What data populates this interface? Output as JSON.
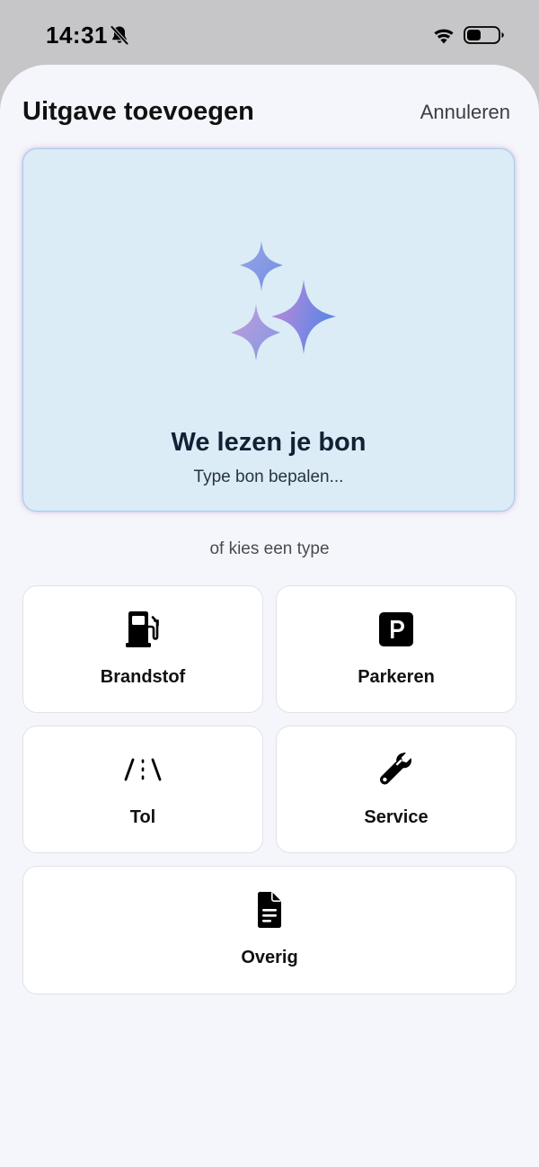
{
  "status_bar": {
    "time": "14:31",
    "icons": [
      "bell-slash-icon",
      "wifi-icon",
      "battery-icon"
    ]
  },
  "sheet": {
    "title": "Uitgave toevoegen",
    "cancel_label": "Annuleren"
  },
  "scan_card": {
    "icon": "sparkles-icon",
    "title": "We lezen je bon",
    "subtitle": "Type bon bepalen..."
  },
  "divider_text": "of kies een type",
  "types": [
    {
      "label": "Brandstof",
      "icon": "fuel-pump-icon"
    },
    {
      "label": "Parkeren",
      "icon": "parking-icon"
    },
    {
      "label": "Tol",
      "icon": "road-icon"
    },
    {
      "label": "Service",
      "icon": "wrench-icon"
    },
    {
      "label": "Overig",
      "icon": "document-icon"
    }
  ],
  "colors": {
    "sheet_background": "#f5f6fb",
    "scan_card_background": "#dbecf7",
    "sparkle_gradient_start": "#c48ad8",
    "sparkle_gradient_end": "#5b86e5"
  }
}
